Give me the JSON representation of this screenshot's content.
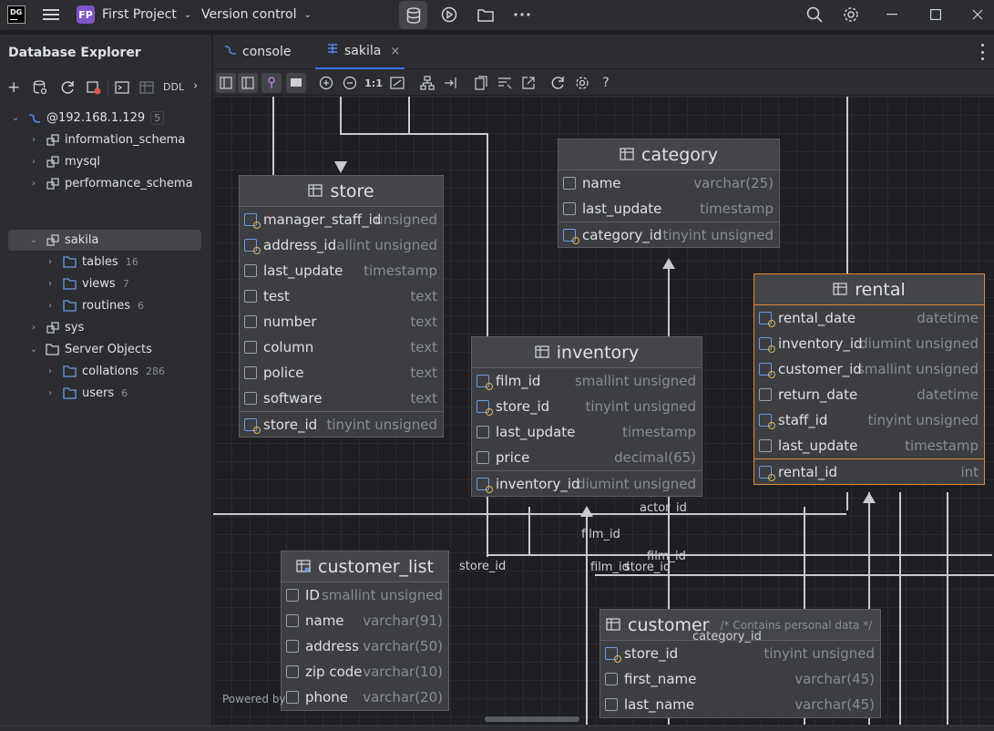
{
  "titlebar": {
    "project_badge": "FP",
    "project_name": "First Project",
    "vcs": "Version control"
  },
  "sidebar": {
    "title": "Database Explorer",
    "toolbar_ddl": "DDL",
    "tree": [
      {
        "label": "@192.168.1.129",
        "count": "5"
      },
      {
        "label": "information_schema"
      },
      {
        "label": "mysql"
      },
      {
        "label": "performance_schema"
      },
      {
        "label": "sakila"
      },
      {
        "label": "tables",
        "count": "16"
      },
      {
        "label": "views",
        "count": "7"
      },
      {
        "label": "routines",
        "count": "6"
      },
      {
        "label": "sys"
      },
      {
        "label": "Server Objects"
      },
      {
        "label": "collations",
        "count": "286"
      },
      {
        "label": "users",
        "count": "6"
      }
    ]
  },
  "tabs": [
    {
      "label": "console"
    },
    {
      "label": "sakila"
    }
  ],
  "toolbar": {
    "zoom_label": "1:1",
    "help": "?"
  },
  "diagram": {
    "store": {
      "title": "store",
      "rows": [
        {
          "name": "manager_staff_id",
          "type": "unsigned"
        },
        {
          "name": "address_id",
          "type": "allint unsigned"
        },
        {
          "name": "last_update",
          "type": "timestamp"
        },
        {
          "name": "test",
          "type": "text"
        },
        {
          "name": "number",
          "type": "text"
        },
        {
          "name": "column",
          "type": "text"
        },
        {
          "name": "police",
          "type": "text"
        },
        {
          "name": "software",
          "type": "text"
        },
        {
          "name": "store_id",
          "type": "tinyint unsigned"
        }
      ]
    },
    "category": {
      "title": "category",
      "rows": [
        {
          "name": "name",
          "type": "varchar(25)"
        },
        {
          "name": "last_update",
          "type": "timestamp"
        },
        {
          "name": "category_id",
          "type": "tinyint unsigned"
        }
      ]
    },
    "inventory": {
      "title": "inventory",
      "rows": [
        {
          "name": "film_id",
          "type": "smallint unsigned"
        },
        {
          "name": "store_id",
          "type": "tinyint unsigned"
        },
        {
          "name": "last_update",
          "type": "timestamp"
        },
        {
          "name": "price",
          "type": "decimal(65)"
        },
        {
          "name": "inventory_id",
          "type": "diumint unsigned"
        }
      ]
    },
    "rental": {
      "title": "rental",
      "rows": [
        {
          "name": "rental_date",
          "type": "datetime"
        },
        {
          "name": "inventory_id",
          "type": "diumint unsigned"
        },
        {
          "name": "customer_id",
          "type": "smallint unsigned"
        },
        {
          "name": "return_date",
          "type": "datetime"
        },
        {
          "name": "staff_id",
          "type": "tinyint unsigned"
        },
        {
          "name": "last_update",
          "type": "timestamp"
        },
        {
          "name": "rental_id",
          "type": "int"
        }
      ]
    },
    "customer_list": {
      "title": "customer_list",
      "rows": [
        {
          "name": "ID",
          "type": "smallint unsigned"
        },
        {
          "name": "name",
          "type": "varchar(91)"
        },
        {
          "name": "address",
          "type": "varchar(50)"
        },
        {
          "name": "zip code",
          "type": "varchar(10)"
        },
        {
          "name": "phone",
          "type": "varchar(20)"
        }
      ]
    },
    "customer": {
      "title": "customer",
      "comment": "/* Contains personal data */",
      "rows": [
        {
          "name": "store_id",
          "type": "tinyint unsigned"
        },
        {
          "name": "first_name",
          "type": "varchar(45)"
        },
        {
          "name": "last_name",
          "type": "varchar(45)"
        }
      ]
    },
    "edge_labels": {
      "actor_id": "actor_id",
      "film_id_1": "film_id",
      "store_id_1": "store_id",
      "film_id_2": "film_id",
      "film_id_3": "film_id",
      "store_id_2": "store_id",
      "category_id": "category_id"
    },
    "powered_by": "Powered by"
  }
}
